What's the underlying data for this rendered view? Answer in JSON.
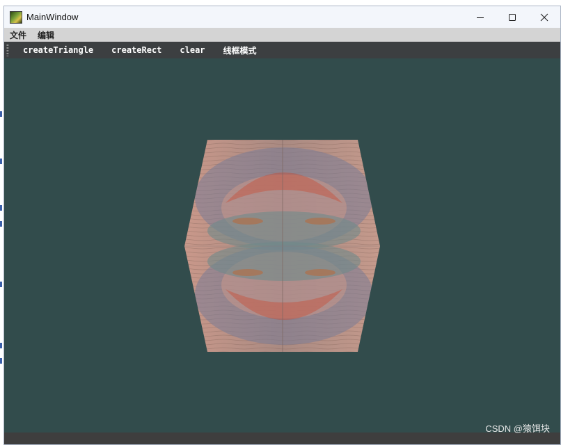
{
  "window": {
    "title": "MainWindow",
    "controls": [
      "minimize",
      "maximize",
      "close"
    ]
  },
  "menu": {
    "items": [
      {
        "label": "文件"
      },
      {
        "label": "编辑"
      }
    ]
  },
  "toolbar": {
    "buttons": [
      {
        "label": "createTriangle"
      },
      {
        "label": "createRect"
      },
      {
        "label": "clear"
      },
      {
        "label": "线框模式"
      }
    ]
  },
  "viewport": {
    "background_color": "#324c4c",
    "content": "textured-cube"
  },
  "watermark": {
    "text": "CSDN @猿饵块"
  }
}
